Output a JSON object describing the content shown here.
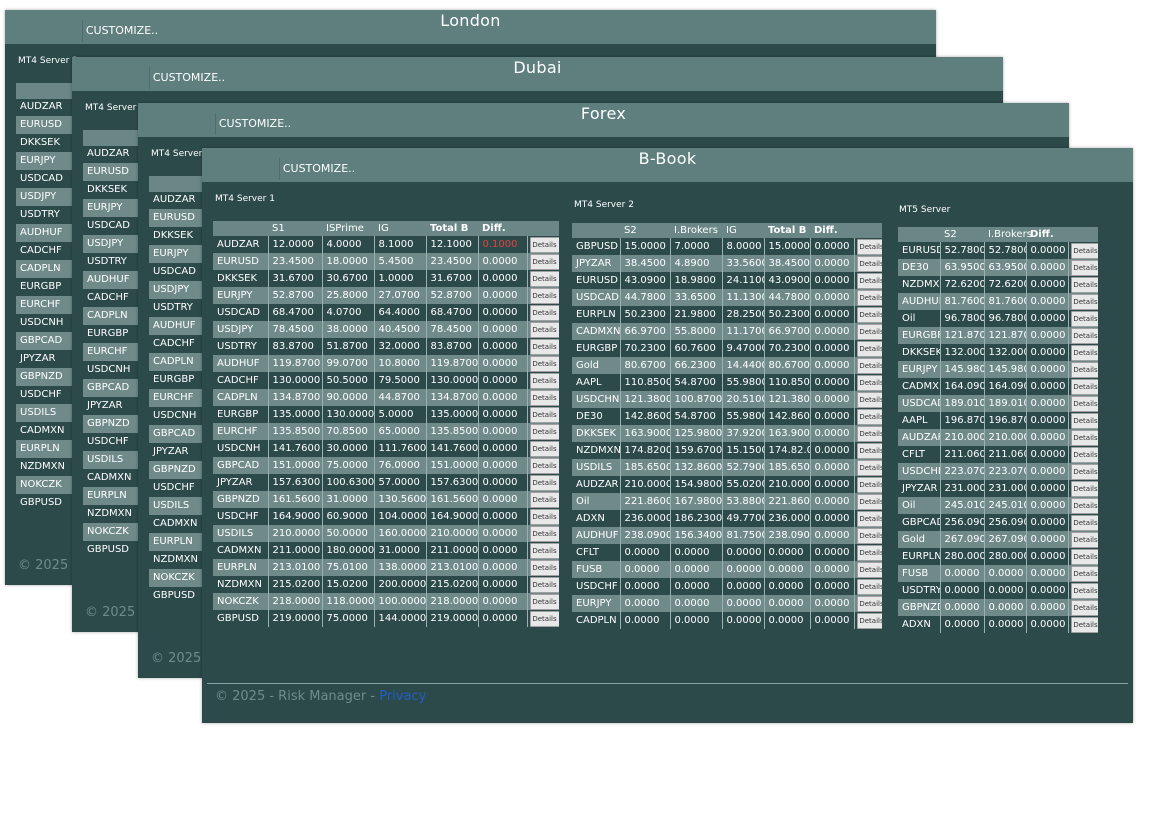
{
  "panels": {
    "london": {
      "title": "London",
      "customize": "CUSTOMIZE..",
      "server_label": "MT4 Server 1",
      "symbols": [
        "AUDZAR",
        "EURUSD",
        "DKKSEK",
        "EURJPY",
        "USDCAD",
        "USDJPY",
        "USDTRY",
        "AUDHUF",
        "CADCHF",
        "CADPLN",
        "EURGBP",
        "EURCHF",
        "USDCNH",
        "GBPCAD",
        "JPYZAR",
        "GBPNZD",
        "USDCHF",
        "USDILS",
        "CADMXN",
        "EURPLN",
        "NZDMXN",
        "NOKCZK",
        "GBPUSD"
      ],
      "footer": "© 2025 - R"
    },
    "dubai": {
      "title": "Dubai",
      "customize": "CUSTOMIZE..",
      "server_label": "MT4 Server 1",
      "symbols": [
        "AUDZAR",
        "EURUSD",
        "DKKSEK",
        "EURJPY",
        "USDCAD",
        "USDJPY",
        "USDTRY",
        "AUDHUF",
        "CADCHF",
        "CADPLN",
        "EURGBP",
        "EURCHF",
        "USDCNH",
        "GBPCAD",
        "JPYZAR",
        "GBPNZD",
        "USDCHF",
        "USDILS",
        "CADMXN",
        "EURPLN",
        "NZDMXN",
        "NOKCZK",
        "GBPUSD"
      ],
      "footer": "© 2025 - R"
    },
    "forex": {
      "title": "Forex",
      "customize": "CUSTOMIZE..",
      "server_label": "MT4 Server 1",
      "symbols": [
        "AUDZAR",
        "EURUSD",
        "DKKSEK",
        "EURJPY",
        "USDCAD",
        "USDJPY",
        "USDTRY",
        "AUDHUF",
        "CADCHF",
        "CADPLN",
        "EURGBP",
        "EURCHF",
        "USDCNH",
        "GBPCAD",
        "JPYZAR",
        "GBPNZD",
        "USDCHF",
        "USDILS",
        "CADMXN",
        "EURPLN",
        "NZDMXN",
        "NOKCZK",
        "GBPUSD"
      ],
      "footer": "© 2025 - R"
    },
    "bbook": {
      "title": "B-Book",
      "customize": "CUSTOMIZE..",
      "footer_text": "© 2025 - Risk Manager - ",
      "footer_link": "Privacy",
      "details_label": "Details",
      "server1": {
        "label": "MT4 Server 1",
        "headers": [
          "",
          "S1",
          "ISPrime",
          "IG",
          "Total B",
          "Diff."
        ],
        "rows": [
          [
            "AUDZAR",
            "12.0000",
            "4.0000",
            "8.1000",
            "12.1000",
            "0.1000"
          ],
          [
            "EURUSD",
            "23.4500",
            "18.0000",
            "5.4500",
            "23.4500",
            "0.0000"
          ],
          [
            "DKKSEK",
            "31.6700",
            "30.6700",
            "1.0000",
            "31.6700",
            "0.0000"
          ],
          [
            "EURJPY",
            "52.8700",
            "25.8000",
            "27.0700",
            "52.8700",
            "0.0000"
          ],
          [
            "USDCAD",
            "68.4700",
            "4.0700",
            "64.4000",
            "68.4700",
            "0.0000"
          ],
          [
            "USDJPY",
            "78.4500",
            "38.0000",
            "40.4500",
            "78.4500",
            "0.0000"
          ],
          [
            "USDTRY",
            "83.8700",
            "51.8700",
            "32.0000",
            "83.8700",
            "0.0000"
          ],
          [
            "AUDHUF",
            "119.8700",
            "99.0700",
            "10.8000",
            "119.8700",
            "0.0000"
          ],
          [
            "CADCHF",
            "130.0000",
            "50.5000",
            "79.5000",
            "130.0000",
            "0.0000"
          ],
          [
            "CADPLN",
            "134.8700",
            "90.0000",
            "44.8700",
            "134.8700",
            "0.0000"
          ],
          [
            "EURGBP",
            "135.0000",
            "130.0000",
            "5.0000",
            "135.0000",
            "0.0000"
          ],
          [
            "EURCHF",
            "135.8500",
            "70.8500",
            "65.0000",
            "135.8500",
            "0.0000"
          ],
          [
            "USDCNH",
            "141.7600",
            "30.0000",
            "111.7600",
            "141.7600",
            "0.0000"
          ],
          [
            "GBPCAD",
            "151.0000",
            "75.0000",
            "76.0000",
            "151.0000",
            "0.0000"
          ],
          [
            "JPYZAR",
            "157.6300",
            "100.6300",
            "57.0000",
            "157.6300",
            "0.0000"
          ],
          [
            "GBPNZD",
            "161.5600",
            "31.0000",
            "130.5600",
            "161.5600",
            "0.0000"
          ],
          [
            "USDCHF",
            "164.9000",
            "60.9000",
            "104.0000",
            "164.9000",
            "0.0000"
          ],
          [
            "USDILS",
            "210.0000",
            "50.0000",
            "160.0000",
            "210.0000",
            "0.0000"
          ],
          [
            "CADMXN",
            "211.0000",
            "180.0000",
            "31.0000",
            "211.0000",
            "0.0000"
          ],
          [
            "EURPLN",
            "213.0100",
            "75.0100",
            "138.0000",
            "213.0100",
            "0.0000"
          ],
          [
            "NZDMXN",
            "215.0200",
            "15.0200",
            "200.0000",
            "215.0200",
            "0.0000"
          ],
          [
            "NOKCZK",
            "218.0000",
            "118.0000",
            "100.0000",
            "218.0000",
            "0.0000"
          ],
          [
            "GBPUSD",
            "219.0000",
            "75.0000",
            "144.0000",
            "219.0000",
            "0.0000"
          ]
        ]
      },
      "server2": {
        "label": "MT4 Server 2",
        "headers": [
          "",
          "S2",
          "I.Brokers",
          "IG",
          "Total B",
          "Diff."
        ],
        "rows": [
          [
            "GBPUSD",
            "15.0000",
            "7.0000",
            "8.0000",
            "15.0000",
            "0.0000"
          ],
          [
            "JPYZAR",
            "38.4500",
            "4.8900",
            "33.5600",
            "38.4500",
            "0.0000"
          ],
          [
            "EURUSD",
            "43.0900",
            "18.9800",
            "24.1100",
            "43.0900",
            "0.0000"
          ],
          [
            "USDCAD",
            "44.7800",
            "33.6500",
            "11.1300",
            "44.7800",
            "0.0000"
          ],
          [
            "EURPLN",
            "50.2300",
            "21.9800",
            "28.2500",
            "50.2300",
            "0.0000"
          ],
          [
            "CADMXN",
            "66.9700",
            "55.8000",
            "11.1700",
            "66.9700",
            "0.0000"
          ],
          [
            "EURGBP",
            "70.2300",
            "60.7600",
            "9.47000",
            "70.2300",
            "0.0000"
          ],
          [
            "Gold",
            "80.6700",
            "66.2300",
            "14.4400",
            "80.6700",
            "0.0000"
          ],
          [
            "AAPL",
            "110.8500",
            "54.8700",
            "55.9800",
            "110.8500",
            "0.0000"
          ],
          [
            "USDCHN",
            "121.3800",
            "100.8700",
            "20.5100",
            "121.3800",
            "0.0000"
          ],
          [
            "DE30",
            "142.8600",
            "54.8700",
            "55.9800",
            "142.8600",
            "0.0000"
          ],
          [
            "DKKSEK",
            "163.9000",
            "125.9800",
            "37.9200",
            "163.9000",
            "0.0000"
          ],
          [
            "NZDMXN",
            "174.8200",
            "159.6700",
            "15.1500",
            "174.82.00",
            "0.0000"
          ],
          [
            "USDILS",
            "185.6500",
            "132.8600",
            "52.7900",
            "185.6500",
            "0.0000"
          ],
          [
            "AUDZAR",
            "210.0000",
            "154.9800",
            "55.0200",
            "210.0000",
            "0.0000"
          ],
          [
            "Oil",
            "221.8600",
            "167.9800",
            "53.8800",
            "221.8600",
            "0.0000"
          ],
          [
            "ADXN",
            "236.0000",
            "186.2300",
            "49.7700",
            "236.0000",
            "0.0000"
          ],
          [
            "AUDHUF",
            "238.0900",
            "156.3400",
            "81.7500",
            "238.0900",
            "0.0000"
          ],
          [
            "CFLT",
            "0.0000",
            "0.0000",
            "0.0000",
            "0.0000",
            "0.0000"
          ],
          [
            "FUSB",
            "0.0000",
            "0.0000",
            "0.0000",
            "0.0000",
            "0.0000"
          ],
          [
            "USDCHF",
            "0.0000",
            "0.0000",
            "0.0000",
            "0.0000",
            "0.0000"
          ],
          [
            "EURJPY",
            "0.0000",
            "0.0000",
            "0.0000",
            "0.0000",
            "0.0000"
          ],
          [
            "CADPLN",
            "0.0000",
            "0.0000",
            "0.0000",
            "0.0000",
            "0.0000"
          ]
        ]
      },
      "server3": {
        "label": "MT5 Server",
        "headers": [
          "",
          "S2",
          "I.Brokers",
          "Diff."
        ],
        "rows": [
          [
            "EURUSD",
            "52.7800",
            "52.7800",
            "0.0000"
          ],
          [
            "DE30",
            "63.9500",
            "63.9500",
            "0.0000"
          ],
          [
            "NZDMXN",
            "72.6200",
            "72.6200",
            "0.0000"
          ],
          [
            "AUDHUF",
            "81.7600",
            "81.7600",
            "0.0000"
          ],
          [
            "Oil",
            "96.7800",
            "96.7800",
            "0.0000"
          ],
          [
            "EURGBP",
            "121.8700",
            "121.8700",
            "0.0000"
          ],
          [
            "DKKSEK",
            "132.0000",
            "132.0000",
            "0.0000"
          ],
          [
            "EURJPY",
            "145.9800",
            "145.9800",
            "0.0000"
          ],
          [
            "CADMXN",
            "164.0900",
            "164.0900",
            "0.0000"
          ],
          [
            "USDCAD",
            "189.0100",
            "189.0100",
            "0.0000"
          ],
          [
            "AAPL",
            "196.8700",
            "196.8700",
            "0.0000"
          ],
          [
            "AUDZAR",
            "210.0000",
            "210.0000",
            "0.0000"
          ],
          [
            "CFLT",
            "211.0600",
            "211.0600",
            "0.0000"
          ],
          [
            "USDCHN",
            "223.0700",
            "223.0700",
            "0.0000"
          ],
          [
            "JPYZAR",
            "231.0000",
            "231.0000",
            "0.0000"
          ],
          [
            "Oil",
            "245.0100",
            "245.0100",
            "0.0000"
          ],
          [
            "GBPCAD",
            "256.0900",
            "256.0900",
            "0.0000"
          ],
          [
            "Gold",
            "267.0900",
            "267.0900",
            "0.0000"
          ],
          [
            "EURPLN",
            "280.0000",
            "280.0000",
            "0.0000"
          ],
          [
            "FUSB",
            "0.0000",
            "0.0000",
            "0.0000"
          ],
          [
            "USDTRY",
            "0.0000",
            "0.0000",
            "0.0000"
          ],
          [
            "GBPNZD",
            "0.0000",
            "0.0000",
            "0.0000"
          ],
          [
            "ADXN",
            "0.0000",
            "0.0000",
            "0.0000"
          ]
        ]
      }
    }
  },
  "colors": {
    "panel_bg": "#2d4a4b",
    "titlebar": "#5f7f7f",
    "row_alt": "#708a8a",
    "diff_alert": "#e04040",
    "link": "#1f5fc7"
  }
}
